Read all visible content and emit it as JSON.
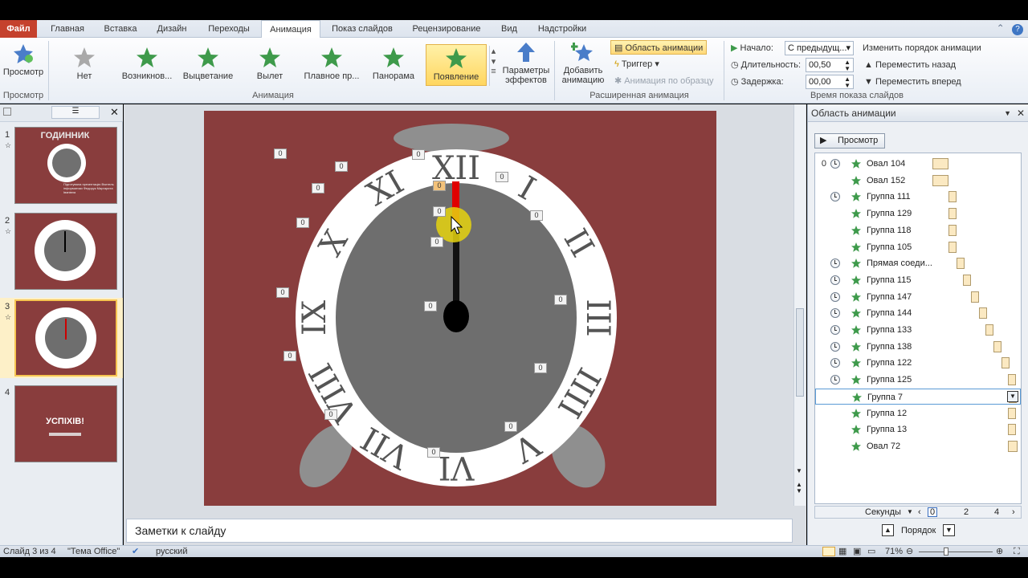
{
  "tabs": [
    {
      "label": "Файл",
      "kind": "file"
    },
    {
      "label": "Главная"
    },
    {
      "label": "Вставка"
    },
    {
      "label": "Дизайн"
    },
    {
      "label": "Переходы"
    },
    {
      "label": "Анимация",
      "active": true
    },
    {
      "label": "Показ слайдов"
    },
    {
      "label": "Рецензирование"
    },
    {
      "label": "Вид"
    },
    {
      "label": "Надстройки"
    }
  ],
  "ribbon": {
    "preview_label": "Просмотр",
    "preview_group": "Просмотр",
    "effects": [
      {
        "label": "Нет",
        "color": "#a9a9a9"
      },
      {
        "label": "Возникнов...",
        "color": "#3e9a4b"
      },
      {
        "label": "Выцветание",
        "color": "#3e9a4b"
      },
      {
        "label": "Вылет",
        "color": "#3e9a4b"
      },
      {
        "label": "Плавное пр...",
        "color": "#3e9a4b"
      },
      {
        "label": "Панорама",
        "color": "#3e9a4b"
      },
      {
        "label": "Появление",
        "color": "#3e9a4b",
        "selected": true
      }
    ],
    "animation_group": "Анимация",
    "effect_params": [
      "Параметры",
      "эффектов"
    ],
    "add_anim": [
      "Добавить",
      "анимацию"
    ],
    "anim_area": "Область анимации",
    "trigger": "Триггер",
    "anim_by_sample": "Анимация по образцу",
    "advanced_group": "Расширенная анимация",
    "start_label": "Начало:",
    "start_value": "С предыдущ...",
    "duration_label": "Длительность:",
    "duration_value": "00,50",
    "delay_label": "Задержка:",
    "delay_value": "00,00",
    "timing_group": "Время показа слайдов",
    "reorder_title": "Изменить порядок анимации",
    "move_back": "Переместить назад",
    "move_forward": "Переместить вперед"
  },
  "slides_panel": {
    "slides": [
      {
        "num": "1",
        "title": "ГОДИННИК",
        "text": "Підготувала презентацію Вчитель інформатики Федорук Маргарита Іванівна"
      },
      {
        "num": "2"
      },
      {
        "num": "3",
        "selected": true
      },
      {
        "num": "4",
        "title": "УСПІХІВ!"
      }
    ]
  },
  "slide": {
    "tags": [
      "0",
      "0",
      "0",
      "0",
      "0",
      "0",
      "0",
      "0",
      "0",
      "0",
      "0",
      "0",
      "0",
      "0",
      "0",
      "0",
      "0",
      "0",
      "0"
    ],
    "numerals": [
      "XII",
      "I",
      "II",
      "III",
      "IIII",
      "V",
      "VI",
      "VII",
      "VIII",
      "IX",
      "X",
      "XI"
    ],
    "colors": {
      "background": "#893d3d",
      "ring": "#ffffff",
      "dial": "#6e6e6e",
      "feet": "#8f8f8f",
      "hand": "#e00000"
    }
  },
  "notes": {
    "placeholder": "Заметки к слайду"
  },
  "pane": {
    "title": "Область анимации",
    "play": "Просмотр",
    "items": [
      {
        "num": "0",
        "clock": true,
        "name": "Овал 104"
      },
      {
        "num": "",
        "clock": false,
        "name": "Овал 152"
      },
      {
        "num": "",
        "clock": true,
        "name": "Группа 111"
      },
      {
        "num": "",
        "clock": false,
        "name": "Группа 129"
      },
      {
        "num": "",
        "clock": false,
        "name": "Группа 118"
      },
      {
        "num": "",
        "clock": false,
        "name": "Группа 105"
      },
      {
        "num": "",
        "clock": true,
        "name": "Прямая соеди..."
      },
      {
        "num": "",
        "clock": true,
        "name": "Группа 115"
      },
      {
        "num": "",
        "clock": true,
        "name": "Группа 147"
      },
      {
        "num": "",
        "clock": true,
        "name": "Группа 144"
      },
      {
        "num": "",
        "clock": true,
        "name": "Группа 133"
      },
      {
        "num": "",
        "clock": true,
        "name": "Группа 138"
      },
      {
        "num": "",
        "clock": true,
        "name": "Группа 122"
      },
      {
        "num": "",
        "clock": true,
        "name": "Группа 125"
      },
      {
        "num": "",
        "clock": false,
        "name": "Группа 7",
        "selected": true
      },
      {
        "num": "",
        "clock": false,
        "name": "Группа 12"
      },
      {
        "num": "",
        "clock": false,
        "name": "Группа 13"
      },
      {
        "num": "",
        "clock": false,
        "name": "Овал 72"
      }
    ],
    "timeline_label": "Секунды",
    "timeline_ticks": [
      "0",
      "2",
      "4"
    ],
    "order_label": "Порядок"
  },
  "status": {
    "slide": "Слайд 3 из 4",
    "theme": "\"Тема Office\"",
    "lang": "русский",
    "zoom": "71%"
  }
}
